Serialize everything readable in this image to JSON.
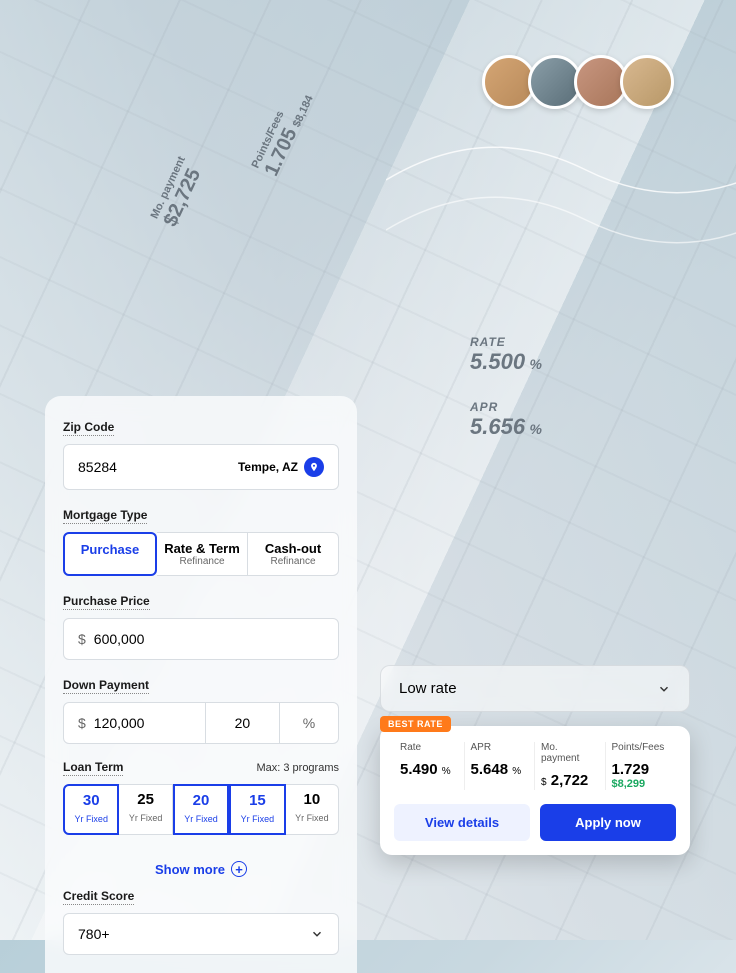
{
  "building_overlays": {
    "mo_payment": {
      "label": "Mo. payment",
      "value": "$2,725"
    },
    "points_fees": {
      "label": "Points/Fees",
      "value": "1.705",
      "sub": "$8,184"
    },
    "rate": {
      "label": "RATE",
      "value": "5.500",
      "unit": "%"
    },
    "apr": {
      "label": "APR",
      "value": "5.656",
      "unit": "%"
    }
  },
  "form": {
    "zip": {
      "label": "Zip Code",
      "value": "85284",
      "location": "Tempe, AZ"
    },
    "mortgage_type": {
      "label": "Mortgage Type",
      "options": [
        {
          "title": "Purchase",
          "sub": ""
        },
        {
          "title": "Rate & Term",
          "sub": "Refinance"
        },
        {
          "title": "Cash-out",
          "sub": "Refinance"
        }
      ]
    },
    "purchase_price": {
      "label": "Purchase Price",
      "currency": "$",
      "value": "600,000"
    },
    "down_payment": {
      "label": "Down Payment",
      "currency": "$",
      "value": "120,000",
      "percent": "20",
      "percent_sym": "%"
    },
    "loan_term": {
      "label": "Loan Term",
      "hint": "Max: 3 programs",
      "options": [
        {
          "n": "30",
          "t": "Yr Fixed",
          "selected": true
        },
        {
          "n": "25",
          "t": "Yr Fixed",
          "selected": false
        },
        {
          "n": "20",
          "t": "Yr Fixed",
          "selected": true
        },
        {
          "n": "15",
          "t": "Yr Fixed",
          "selected": true
        },
        {
          "n": "10",
          "t": "Yr Fixed",
          "selected": false
        }
      ]
    },
    "show_more": "Show more",
    "credit_score": {
      "label": "Credit Score",
      "value": "780+"
    }
  },
  "results": {
    "sort": "Low rate",
    "best_badge": "BEST RATE",
    "card": {
      "rate": {
        "label": "Rate",
        "value": "5.490",
        "unit": "%"
      },
      "apr": {
        "label": "APR",
        "value": "5.648",
        "unit": "%"
      },
      "mo": {
        "label": "Mo. payment",
        "prefix": "$",
        "value": "2,722"
      },
      "points": {
        "label": "Points/Fees",
        "value": "1.729",
        "sub": "$8,299"
      }
    },
    "view_details": "View details",
    "apply_now": "Apply now"
  }
}
